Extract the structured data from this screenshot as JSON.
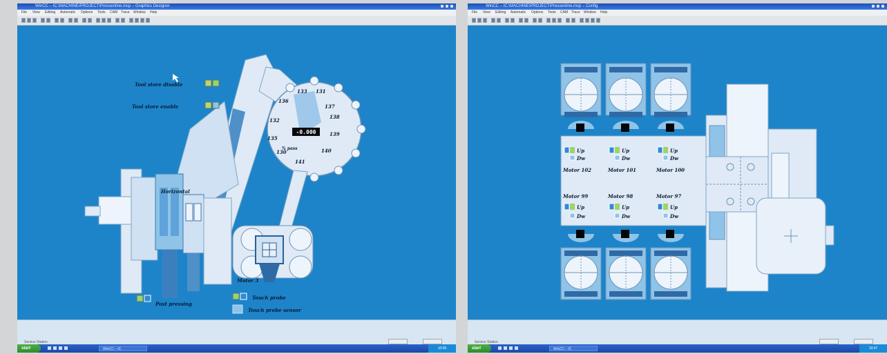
{
  "left_screen": {
    "title": "WinCC – IC:\\MACHINE\\PROJECT\\Pressenline.mcp – Graphics Designer",
    "menu": [
      "File",
      "View",
      "Editing",
      "Automatic",
      "Options",
      "Tools",
      "CAM",
      "Trace",
      "Window",
      "Help"
    ],
    "labels": {
      "tool_store_disable": "Tool store disable",
      "tool_store_enable": "Tool store enable",
      "horizontal": "Horizontal",
      "post_pressing": "Post pressing",
      "touch_probe": "Touch probe",
      "touch_probe_sensor": "Touch probe sensor",
      "motor": "Motor 3",
      "readout_value": "-0.000",
      "readout_unit": "% pass"
    },
    "station_numbers": [
      "133",
      "131",
      "136",
      "137",
      "138",
      "132",
      "139",
      "135",
      "140",
      "130",
      "141"
    ],
    "status_text": "Service Station",
    "start_label": "start",
    "task_label": "WinCC – IC",
    "tray_time": "10:45"
  },
  "right_screen": {
    "title": "WinCC – IC:\\MACHINE\\PROJECT\\Pressenline.mcp – Config",
    "menu": [
      "File",
      "View",
      "Editing",
      "Automatic",
      "Options",
      "Tools",
      "CAM",
      "Trace",
      "Window",
      "Help"
    ],
    "motor_labels_top": [
      "Motor 102",
      "Motor 101",
      "Motor 100"
    ],
    "motor_labels_bottom": [
      "Motor 99",
      "Motor 98",
      "Motor 97"
    ],
    "up_label": "Up",
    "down_label": "Dw",
    "status_text": "Service Station",
    "start_label": "start",
    "task_label": "WinCC – IC",
    "tray_time": "10:47"
  },
  "colors": {
    "screen_bg": "#1d84c9",
    "machine_light": "#dfeaf6",
    "machine_mid": "#8fc3e8",
    "highlight_green": "#9ed36a",
    "indicator_blue": "#2f8bd6"
  }
}
